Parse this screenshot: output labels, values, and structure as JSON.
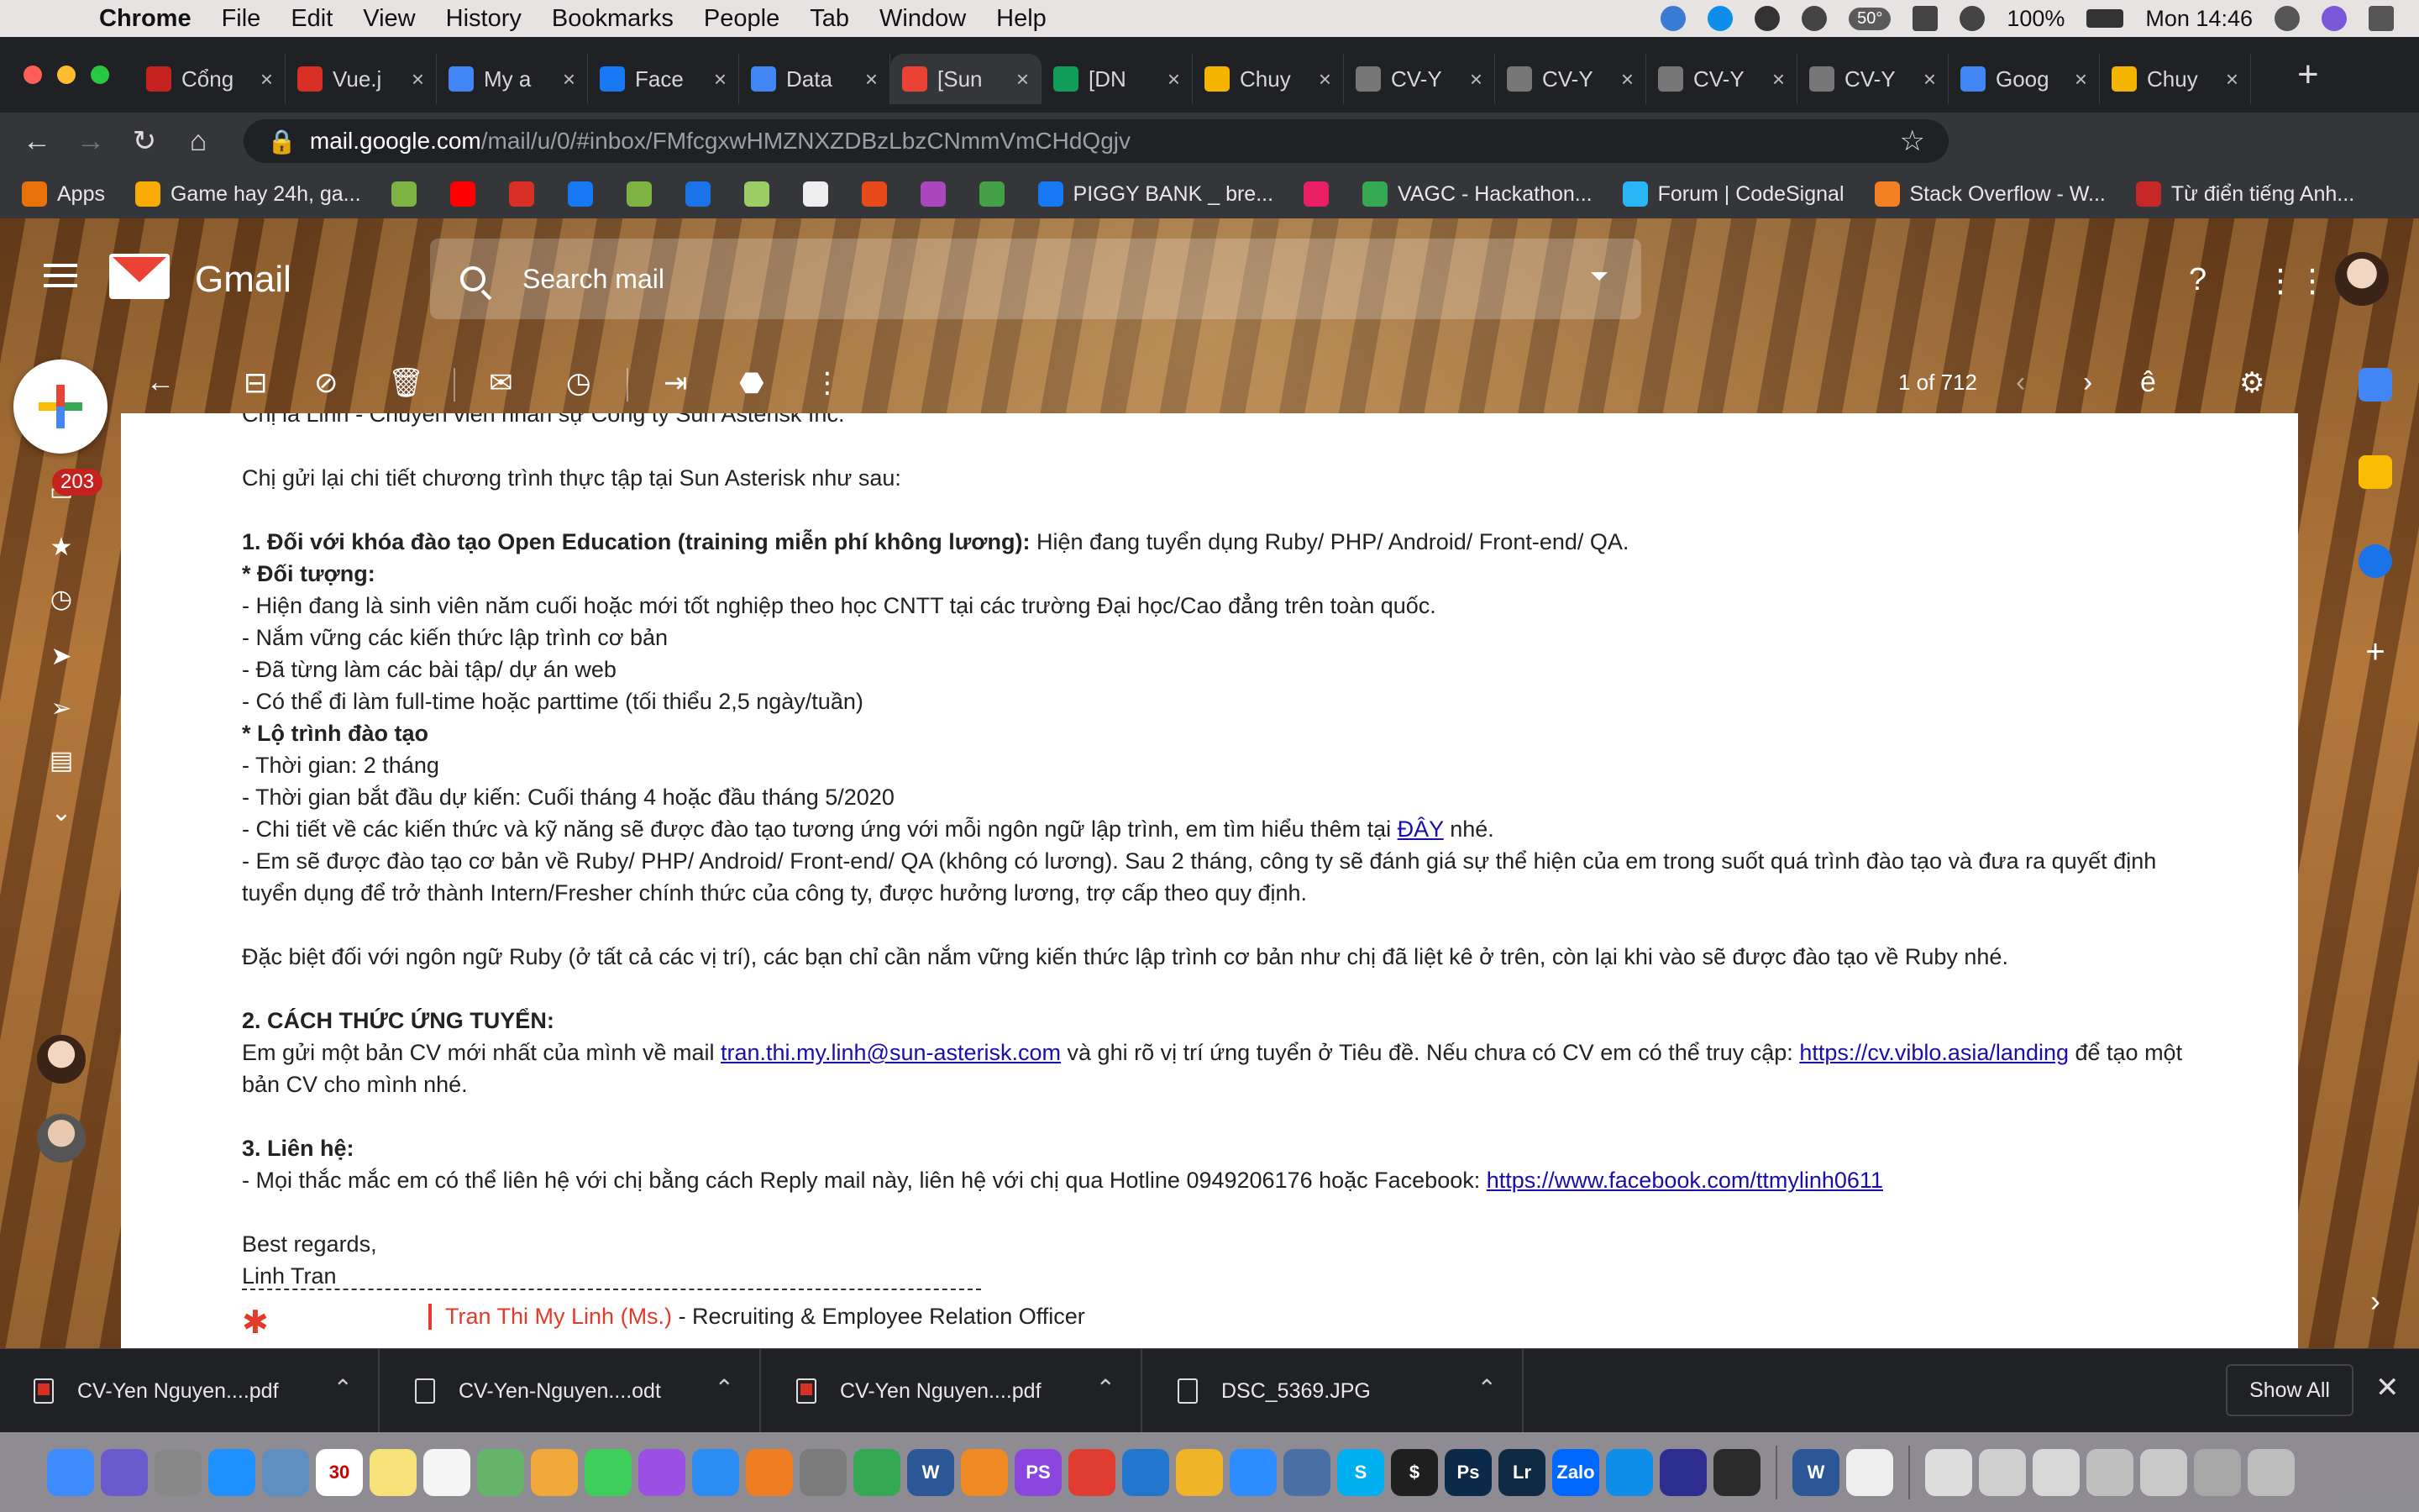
{
  "menubar": {
    "app": "Chrome",
    "items": [
      "File",
      "Edit",
      "View",
      "History",
      "Bookmarks",
      "People",
      "Tab",
      "Window",
      "Help"
    ],
    "temp": "50°",
    "battery": "100%",
    "clock": "Mon 14:46"
  },
  "tabs": [
    {
      "title": "Cổng",
      "icon": "portal-icon",
      "color": "#c5221f"
    },
    {
      "title": "Vue.j",
      "icon": "t-icon",
      "color": "#d93025"
    },
    {
      "title": "My a",
      "icon": "gear-icon",
      "color": "#4285f4"
    },
    {
      "title": "Face",
      "icon": "facebook-icon",
      "color": "#1877f2"
    },
    {
      "title": "Data",
      "icon": "gear-icon",
      "color": "#4285f4"
    },
    {
      "title": "[Sun",
      "icon": "gmail-icon",
      "color": "#ea4335"
    },
    {
      "title": "[DN",
      "icon": "sheets-icon",
      "color": "#0f9d58"
    },
    {
      "title": "Chuy",
      "icon": "color-icon",
      "color": "#f4b400"
    },
    {
      "title": "CV-Y",
      "icon": "globe-icon",
      "color": "#777777"
    },
    {
      "title": "CV-Y",
      "icon": "globe-icon",
      "color": "#777777"
    },
    {
      "title": "CV-Y",
      "icon": "globe-icon",
      "color": "#777777"
    },
    {
      "title": "CV-Y",
      "icon": "globe-icon",
      "color": "#777777"
    },
    {
      "title": "Goog",
      "icon": "google-icon",
      "color": "#4285f4"
    },
    {
      "title": "Chuy",
      "icon": "color-icon",
      "color": "#f4b400"
    }
  ],
  "address": {
    "host": "mail.google.com",
    "path": "/mail/u/0/#inbox/FMfcgxwHMZNXZDBzLbzCNmmVmCHdQgjv"
  },
  "bookmarks": [
    {
      "label": "Apps",
      "color": "#e8710a"
    },
    {
      "label": "Game hay 24h, ga...",
      "color": "#f9ab00"
    },
    {
      "label": "",
      "color": "#7cb342"
    },
    {
      "label": "",
      "color": "#ff0000"
    },
    {
      "label": "",
      "color": "#d93025"
    },
    {
      "label": "",
      "color": "#1877f2"
    },
    {
      "label": "",
      "color": "#7cb342"
    },
    {
      "label": "",
      "color": "#1a73e8"
    },
    {
      "label": "",
      "color": "#9ccc65"
    },
    {
      "label": "",
      "color": "#eeeeee"
    },
    {
      "label": "",
      "color": "#e64a19"
    },
    {
      "label": "",
      "color": "#ab47bc"
    },
    {
      "label": "",
      "color": "#43a047"
    },
    {
      "label": "PIGGY BANK _ bre...",
      "color": "#1877f2"
    },
    {
      "label": "",
      "color": "#e91e63"
    },
    {
      "label": "VAGC - Hackathon...",
      "color": "#34a853"
    },
    {
      "label": "Forum | CodeSignal",
      "color": "#29b6f6"
    },
    {
      "label": "Stack Overflow - W...",
      "color": "#f48024"
    },
    {
      "label": "Từ điển tiếng Anh...",
      "color": "#c62828"
    }
  ],
  "gmail": {
    "title": "Gmail",
    "search_placeholder": "Search mail",
    "inbox_count": "203",
    "pager": "1 of 712"
  },
  "message": {
    "lines": [
      "Chị là Linh - Chuyên viên nhân sự Công ty Sun Asterisk Inc.",
      "",
      "Chị gửi lại chi tiết chương trình thực tập tại Sun Asterisk như sau:",
      "",
      "",
      "",
      "-  Hiện đang là sinh viên năm cuối hoặc mới tốt nghiệp theo học CNTT tại các trường Đại học/Cao đẳng trên toàn quốc.",
      "- Nắm vững các kiến thức lập trình cơ bản",
      "- Đã từng làm các bài tập/ dự án web",
      "- Có thể đi làm full-time hoặc parttime (tối thiểu 2,5 ngày/tuần)",
      "",
      "- Thời gian: 2 tháng",
      "- Thời gian bắt đầu dự kiến: Cuối tháng 4 hoặc đầu tháng 5/2020"
    ],
    "heading1": "1. Đối với khóa đào tạo Open Education (training miễn phí không lương):",
    "heading1_rest": " Hiện đang tuyển dụng Ruby/ PHP/ Android/ Front-end/ QA.",
    "target_heading": "* Đối tượng:",
    "roadmap_heading": "* Lộ trình đào tạo",
    "detail_pre": "- Chi tiết về các kiến thức và kỹ năng sẽ được đào tạo tương ứng với mỗi ngôn ngữ lập trình, em tìm hiểu thêm tại ",
    "detail_link": "ĐÂY",
    "detail_post": " nhé.",
    "training_line": "- Em sẽ được đào tạo cơ bản về Ruby/ PHP/ Android/ Front-end/ QA (không có lương). Sau 2 tháng, công ty sẽ đánh giá sự thể hiện của em trong suốt quá trình đào tạo và đưa ra quyết định tuyển dụng để trở thành Intern/Fresher chính thức của công ty, được hưởng lương, trợ cấp theo quy định.",
    "ruby_note": "Đặc biệt đối với ngôn ngữ Ruby (ở tất cả các vị trí), các bạn chỉ cần nắm vững kiến thức lập trình cơ bản như chị đã liệt kê ở trên, còn lại khi vào sẽ được đào tạo về Ruby nhé.",
    "heading2": "2. CÁCH THỨC ỨNG TUYỂN:",
    "apply_pre": "Em gửi một bản CV mới nhất của mình về mail ",
    "apply_email": "tran.thi.my.linh@sun-asterisk.com",
    "apply_mid": " và ghi rõ vị trí ứng tuyển ở Tiêu đề. Nếu chưa có CV em có thể truy cập: ",
    "apply_link": "https://cv.viblo.asia/landing",
    "apply_post": " để tạo một bản CV cho mình nhé.",
    "heading3": "3. Liên hệ:",
    "contact_pre": "- Mọi thắc mắc em có thể liên hệ với chị bằng cách Reply mail này, liên hệ với chị qua Hotline 0949206176 hoặc Facebook: ",
    "contact_link": "https://www.facebook.com/ttmylinh0611",
    "regards": "Best regards,",
    "sender": "Linh Tran",
    "sig_name": "Tran Thi My Linh (Ms.)",
    "sig_role": " - Recruiting & Employee Relation Officer"
  },
  "downloads": {
    "items": [
      {
        "name": "CV-Yen Nguyen....pdf",
        "type": "pdf"
      },
      {
        "name": "CV-Yen-Nguyen....odt",
        "type": "doc"
      },
      {
        "name": "CV-Yen Nguyen....pdf",
        "type": "pdf"
      },
      {
        "name": "DSC_5369.JPG",
        "type": "img"
      }
    ],
    "show_all": "Show All"
  },
  "dock": {
    "calendar_day": "30",
    "apps": [
      {
        "name": "finder-icon",
        "color": "#3d8bfd",
        "label": ""
      },
      {
        "name": "siri-icon",
        "color": "#6a5acd",
        "label": ""
      },
      {
        "name": "launchpad-icon",
        "color": "#888888",
        "label": ""
      },
      {
        "name": "safari-icon",
        "color": "#1e90ff",
        "label": ""
      },
      {
        "name": "preview-icon",
        "color": "#5f8fbf",
        "label": ""
      },
      {
        "name": "calendar-icon",
        "color": "#ffffff",
        "label": "30"
      },
      {
        "name": "notes-icon",
        "color": "#f7e27a",
        "label": ""
      },
      {
        "name": "reminders-icon",
        "color": "#f5f5f5",
        "label": ""
      },
      {
        "name": "maps-icon",
        "color": "#64b56a",
        "label": ""
      },
      {
        "name": "photos-icon",
        "color": "#f2a93b",
        "label": ""
      },
      {
        "name": "messages-icon",
        "color": "#3ecf5a",
        "label": ""
      },
      {
        "name": "podcasts-icon",
        "color": "#9b4fe3",
        "label": ""
      },
      {
        "name": "appstore-icon",
        "color": "#2b8cf4",
        "label": ""
      },
      {
        "name": "pages-icon",
        "color": "#ef7d22",
        "label": ""
      },
      {
        "name": "settings-icon",
        "color": "#7b7b7b",
        "label": ""
      },
      {
        "name": "chrome-icon",
        "color": "#34a853",
        "label": ""
      },
      {
        "name": "word-icon",
        "color": "#2b5797",
        "label": "W"
      },
      {
        "name": "books-icon",
        "color": "#f08a24",
        "label": ""
      },
      {
        "name": "phpstorm-icon",
        "color": "#8b47dd",
        "label": "PS"
      },
      {
        "name": "git-icon",
        "color": "#e03c2f",
        "label": ""
      },
      {
        "name": "vscode-icon",
        "color": "#2277cc",
        "label": ""
      },
      {
        "name": "star-icon",
        "color": "#f0b429",
        "label": ""
      },
      {
        "name": "zoom-icon",
        "color": "#2d8cff",
        "label": ""
      },
      {
        "name": "network-icon",
        "color": "#4a6fa5",
        "label": ""
      },
      {
        "name": "skype-icon",
        "color": "#00aff0",
        "label": "S"
      },
      {
        "name": "terminal-icon",
        "color": "#1f1f1f",
        "label": "$"
      },
      {
        "name": "photoshop-icon",
        "color": "#0b2a4a",
        "label": "Ps"
      },
      {
        "name": "lightroom-icon",
        "color": "#0f2a43",
        "label": "Lr"
      },
      {
        "name": "zalo-icon",
        "color": "#0068ff",
        "label": "Zalo"
      },
      {
        "name": "teamviewer-icon",
        "color": "#0e8ee9",
        "label": ""
      },
      {
        "name": "hub-icon",
        "color": "#2d2d8f",
        "label": ""
      },
      {
        "name": "console-icon",
        "color": "#2b2b2b",
        "label": ""
      },
      {
        "name": "word2-icon",
        "color": "#2b5797",
        "label": "W"
      },
      {
        "name": "doc-icon",
        "color": "#eeeeee",
        "label": ""
      },
      {
        "name": "file1-icon",
        "color": "#dddddd",
        "label": ""
      },
      {
        "name": "file2-icon",
        "color": "#cfcfcf",
        "label": ""
      },
      {
        "name": "file3-icon",
        "color": "#d7d7d7",
        "label": ""
      },
      {
        "name": "file4-icon",
        "color": "#bfbfbf",
        "label": ""
      },
      {
        "name": "file5-icon",
        "color": "#c9c9c9",
        "label": ""
      },
      {
        "name": "file6-icon",
        "color": "#a8a8a8",
        "label": ""
      },
      {
        "name": "trash-icon",
        "color": "#bdbdbd",
        "label": ""
      }
    ]
  }
}
